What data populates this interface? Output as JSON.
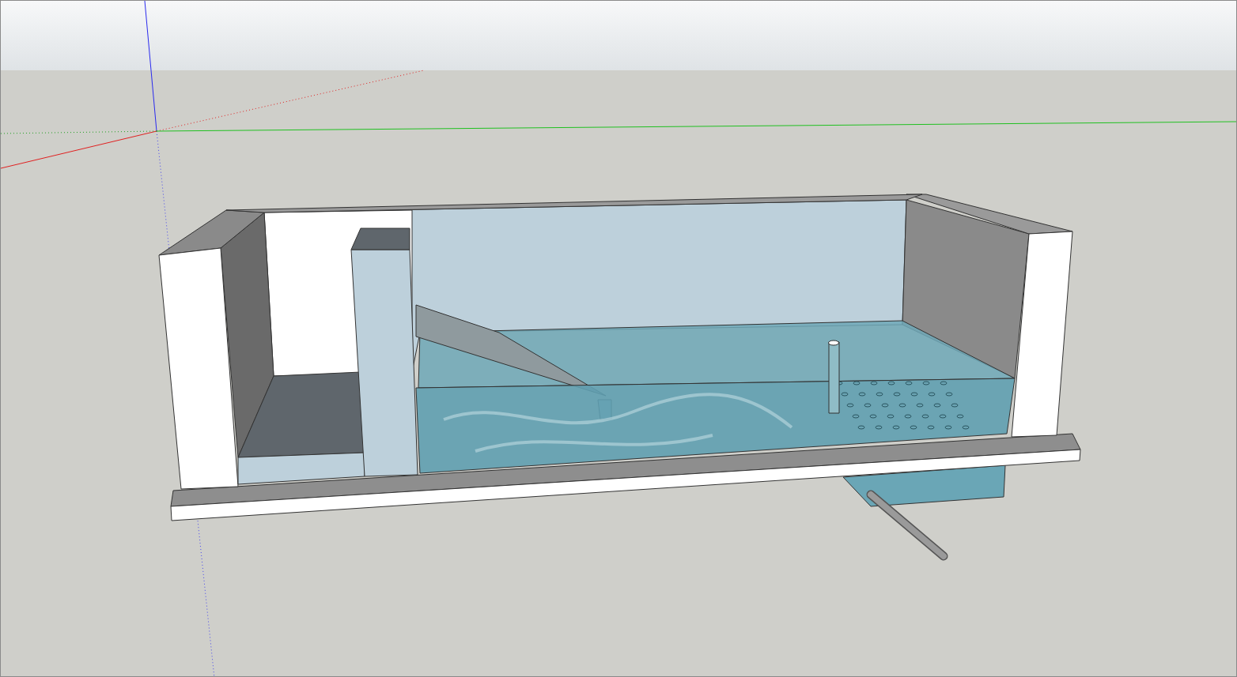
{
  "viewport": {
    "show_axes": true,
    "model": {
      "kind": "tank"
    }
  }
}
